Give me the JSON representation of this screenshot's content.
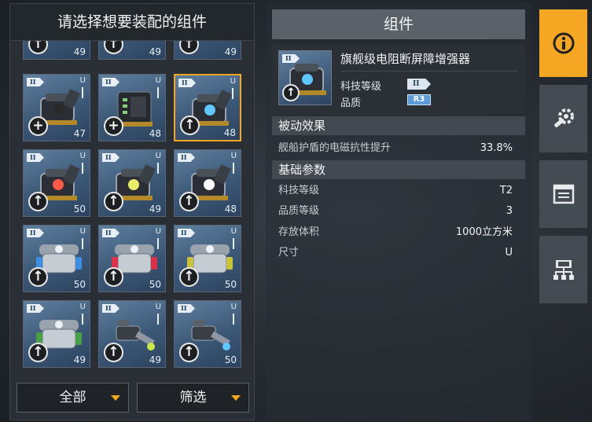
{
  "left": {
    "title": "请选择想要装配的组件",
    "filters": [
      {
        "label": "全部"
      },
      {
        "label": "筛选"
      }
    ],
    "top_partial_levels": [
      "49",
      "49",
      "49"
    ],
    "cards": [
      {
        "tier": "II",
        "size": "U",
        "level": "47",
        "action": "+",
        "selected": false,
        "art": "shield-device",
        "accent": "#2a2a2a"
      },
      {
        "tier": "II",
        "size": "U",
        "level": "48",
        "action": "+",
        "selected": false,
        "art": "rack-device",
        "accent": "#7fd17a"
      },
      {
        "tier": "II",
        "size": "U",
        "level": "48",
        "action": "↑",
        "selected": true,
        "art": "shield-device",
        "accent": "#5fc6ff"
      },
      {
        "tier": "II",
        "size": "U",
        "level": "50",
        "action": "↑",
        "selected": false,
        "art": "shield-device",
        "accent": "#ff5a4a"
      },
      {
        "tier": "II",
        "size": "U",
        "level": "49",
        "action": "↑",
        "selected": false,
        "art": "shield-device",
        "accent": "#e8ee6a"
      },
      {
        "tier": "II",
        "size": "U",
        "level": "48",
        "action": "↑",
        "selected": false,
        "art": "shield-device",
        "accent": "#ffffff"
      },
      {
        "tier": "II",
        "size": "U",
        "level": "50",
        "action": "↑",
        "selected": false,
        "art": "reactor-device",
        "accent": "#3d8de0"
      },
      {
        "tier": "II",
        "size": "U",
        "level": "50",
        "action": "↑",
        "selected": false,
        "art": "reactor-device",
        "accent": "#d8334a"
      },
      {
        "tier": "II",
        "size": "U",
        "level": "50",
        "action": "↑",
        "selected": false,
        "art": "reactor-device",
        "accent": "#c9c23a"
      },
      {
        "tier": "II",
        "size": "U",
        "level": "49",
        "action": "↑",
        "selected": false,
        "art": "reactor-device",
        "accent": "#4aa04a"
      },
      {
        "tier": "II",
        "size": "U",
        "level": "49",
        "action": "↑",
        "selected": false,
        "art": "cannon-device",
        "accent": "#c8e84a"
      },
      {
        "tier": "II",
        "size": "U",
        "level": "50",
        "action": "↑",
        "selected": false,
        "art": "cannon-device",
        "accent": "#5fc6ff"
      }
    ]
  },
  "detail": {
    "header": "组件",
    "item": {
      "name": "旗舰级电阻断屏障增强器",
      "tier_label": "科技等级",
      "tier_value": "II",
      "quality_label": "品质",
      "quality_value": "R3"
    },
    "passive": {
      "title": "被动效果",
      "rows": [
        {
          "label": "舰船护盾的电磁抗性提升",
          "value": "33.8%"
        }
      ]
    },
    "basic": {
      "title": "基础参数",
      "rows": [
        {
          "label": "科技等级",
          "value": "T2"
        },
        {
          "label": "品质等级",
          "value": "3"
        },
        {
          "label": "存放体积",
          "value": "1000立方米"
        },
        {
          "label": "尺寸",
          "value": "U"
        }
      ]
    }
  },
  "tabs": [
    {
      "icon": "info-icon",
      "active": true
    },
    {
      "icon": "wrench-gear-icon",
      "active": false
    },
    {
      "icon": "list-panel-icon",
      "active": false
    },
    {
      "icon": "tech-tree-icon",
      "active": false
    }
  ],
  "colors": {
    "accent": "#f5a623",
    "card_blue": "#3c5877",
    "grade_badge": "#5b9bd8"
  }
}
